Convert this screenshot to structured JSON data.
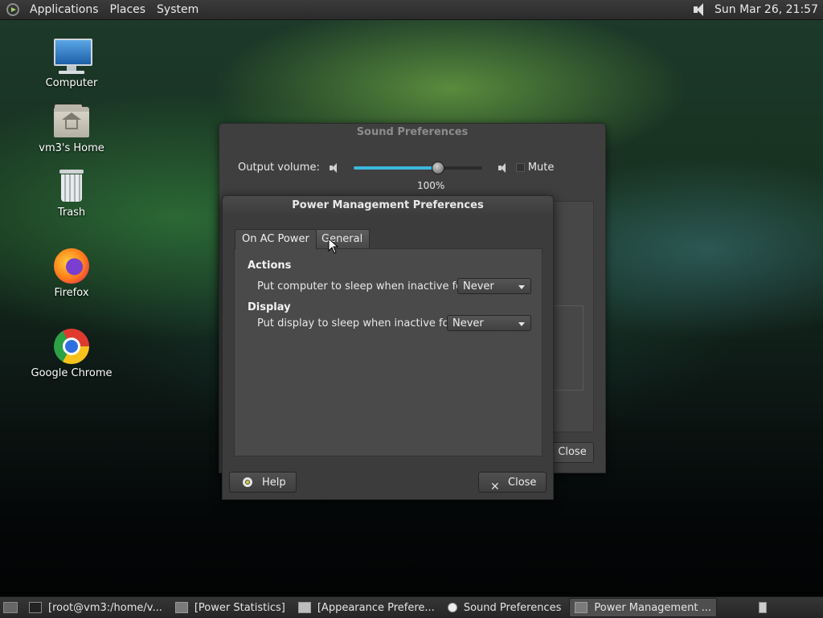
{
  "top_panel": {
    "menus": [
      "Applications",
      "Places",
      "System"
    ],
    "clock": "Sun Mar 26, 21:57"
  },
  "desktop_icons": [
    {
      "label": "Computer",
      "icon": "computer-icon"
    },
    {
      "label": "vm3's Home",
      "icon": "home-folder-icon"
    },
    {
      "label": "Trash",
      "icon": "trash-icon"
    },
    {
      "label": "Firefox",
      "icon": "firefox-icon"
    },
    {
      "label": "Google Chrome",
      "icon": "chrome-icon"
    }
  ],
  "sound_window": {
    "title": "Sound Preferences",
    "output_volume_label": "Output volume:",
    "volume_percent": "100%",
    "volume_value": 0.65,
    "mute_label": "Mute",
    "close_label": "Close"
  },
  "power_window": {
    "title": "Power Management Preferences",
    "tabs": [
      "On AC Power",
      "General"
    ],
    "actions_heading": "Actions",
    "sleep_computer_label": "Put computer to sleep when inactive for:",
    "sleep_computer_value": "Never",
    "display_heading": "Display",
    "sleep_display_label": "Put display to sleep when inactive for:",
    "sleep_display_value": "Never",
    "help_label": "Help",
    "close_label": "Close"
  },
  "taskbar": {
    "tasks": [
      "[root@vm3:/home/v...",
      "[Power Statistics]",
      "[Appearance Prefere...",
      "Sound Preferences",
      "Power Management ..."
    ]
  },
  "colors": {
    "accent": "#3cb8de",
    "panel": "#2b2b2b",
    "window": "#3c3c3c"
  }
}
